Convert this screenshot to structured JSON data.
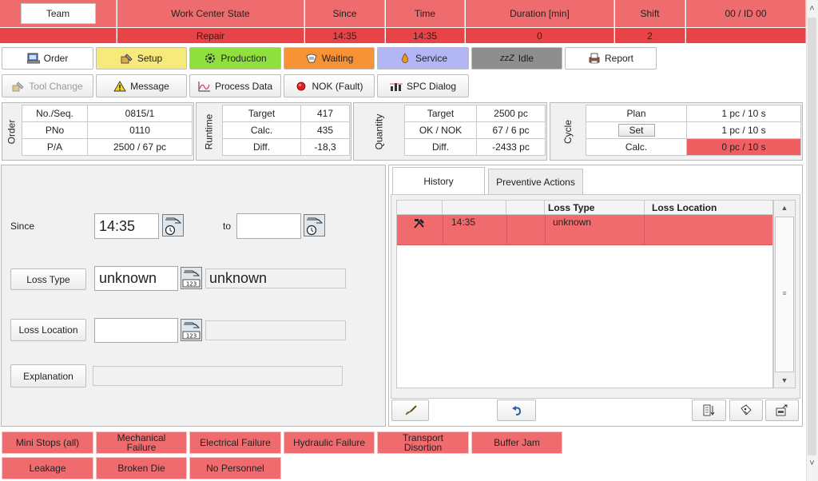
{
  "header": {
    "team_label": "Team",
    "columns": [
      "Work Center State",
      "Since",
      "Time",
      "Duration [min]",
      "Shift",
      "00  / ID 00"
    ],
    "values": [
      "Repair",
      "14:35",
      "14:35",
      "0",
      "2",
      ""
    ]
  },
  "toolbar1": [
    {
      "label": "Order",
      "icon": "order-icon",
      "color": "#ffffff"
    },
    {
      "label": "Setup",
      "icon": "setup-icon",
      "color": "#f7e97b"
    },
    {
      "label": "Production",
      "icon": "gear-icon",
      "color": "#8fe03f"
    },
    {
      "label": "Waiting",
      "icon": "waiting-icon",
      "color": "#f79236"
    },
    {
      "label": "Service",
      "icon": "oil-drop-icon",
      "color": "#b3b6f5"
    },
    {
      "label": "Idle",
      "icon": "sleep-icon",
      "glyph": "zzZ",
      "color": "#8e8e8e"
    },
    {
      "label": "Report",
      "icon": "report-icon",
      "color": "#ffffff"
    }
  ],
  "toolbar2": [
    {
      "label": "Tool Change",
      "icon": "tool-change-icon",
      "disabled": true
    },
    {
      "label": "Message",
      "icon": "warning-icon"
    },
    {
      "label": "Process Data",
      "icon": "chart-icon"
    },
    {
      "label": "NOK (Fault)",
      "icon": "fault-icon"
    },
    {
      "label": "SPC Dialog",
      "icon": "spc-icon"
    }
  ],
  "order": {
    "title": "Order",
    "rows": [
      [
        "No./Seq.",
        "0815/1"
      ],
      [
        "PNo",
        "0110"
      ],
      [
        "P/A",
        "2500  / 67 pc"
      ]
    ]
  },
  "runtime": {
    "title": "Runtime",
    "rows": [
      [
        "Target",
        "417"
      ],
      [
        "Calc.",
        "435"
      ],
      [
        "Diff.",
        "-18,3"
      ]
    ]
  },
  "quantity": {
    "title": "Quantity",
    "rows": [
      [
        "Target",
        "2500 pc"
      ],
      [
        "OK / NOK",
        "67  / 6 pc"
      ],
      [
        "Diff.",
        "-2433 pc"
      ]
    ]
  },
  "cycle": {
    "title": "Cycle",
    "plan_label": "Plan",
    "plan_value": "1 pc  / 10 s",
    "set_label": "Set",
    "set_value": "1 pc  / 10 s",
    "calc_label": "Calc.",
    "calc_value": "0   pc  / 10 s"
  },
  "form": {
    "since_label": "Since",
    "since_value": "14:35",
    "to_label": "to",
    "to_value": "",
    "loss_type_label": "Loss Type",
    "loss_type_value": "unknown",
    "loss_type_text": "unknown",
    "loss_location_label": "Loss Location",
    "loss_location_value": "",
    "explanation_label": "Explanation",
    "explanation_value": ""
  },
  "tabs": [
    "History",
    "Preventive Actions"
  ],
  "history": {
    "columns": [
      "",
      "",
      "",
      "Loss Type",
      "Loss Location"
    ],
    "rows": [
      {
        "icon": "hammer-icon",
        "time": "14:35",
        "blank": "",
        "loss_type": "unknown",
        "loss_location": ""
      }
    ]
  },
  "categories": [
    "Mini Stops (all)",
    "Mechanical Failure",
    "Electrical Failure",
    "Hydraulic Failure",
    "Transport Disortion",
    "Buffer Jam",
    "Leakage",
    "Broken Die",
    "No Personnel"
  ],
  "colors": {
    "header_red": "#ee6c6e",
    "value_red": "#e84346",
    "alert_red": "#ef5f61",
    "panel_bg": "#f1f1f1"
  }
}
